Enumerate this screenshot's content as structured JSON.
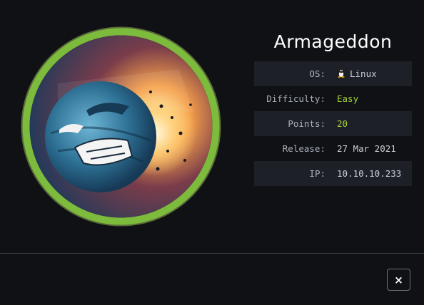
{
  "machine": {
    "name": "Armageddon",
    "details": [
      {
        "label": "OS:",
        "value": "Linux",
        "icon": "tux-icon"
      },
      {
        "label": "Difficulty:",
        "value": "Easy"
      },
      {
        "label": "Points:",
        "value": "20"
      },
      {
        "label": "Release:",
        "value": "27 Mar 2021"
      },
      {
        "label": "IP:",
        "value": "10.10.10.233"
      }
    ]
  },
  "footer": {
    "close_label": "×"
  },
  "colors": {
    "ring": "#7dbb3c",
    "accent": "#a4cf3a",
    "background": "#0f1115",
    "row_shade": "#1d2127"
  }
}
